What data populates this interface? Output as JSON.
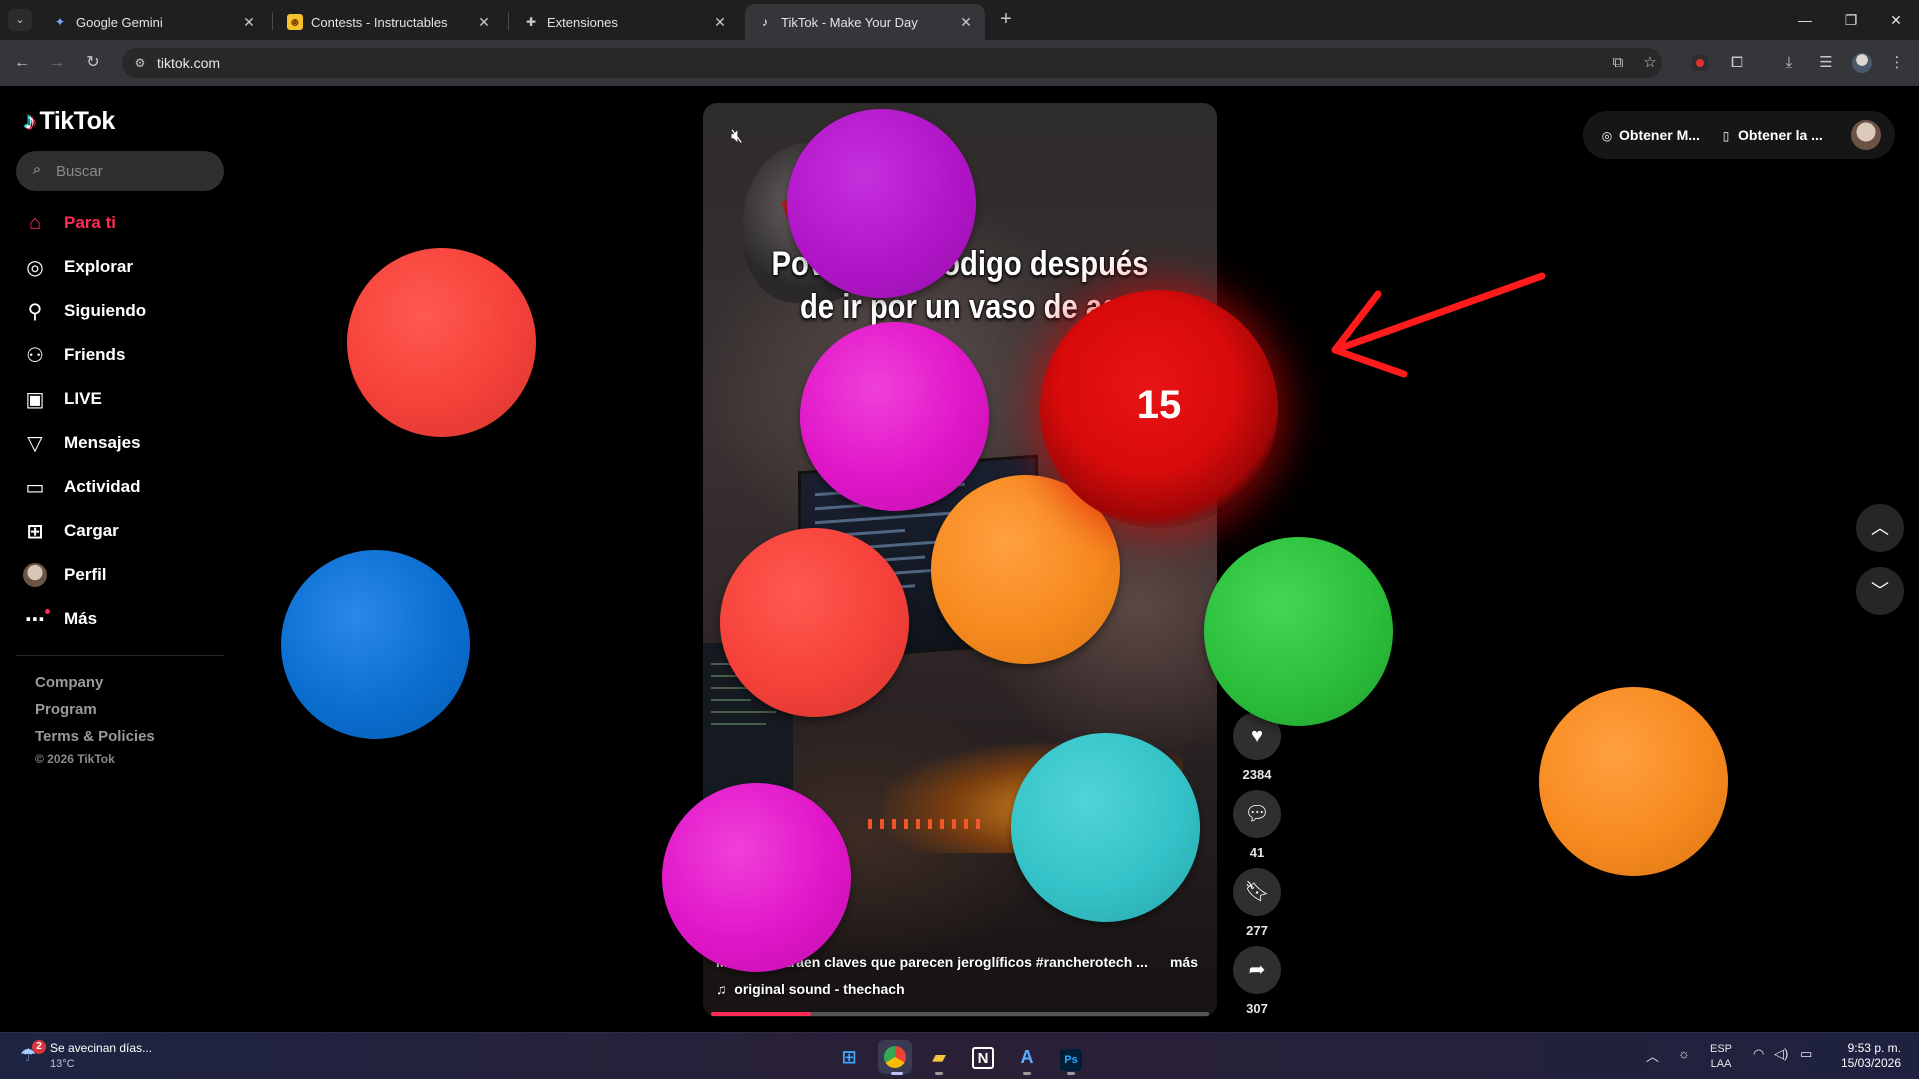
{
  "browser": {
    "tabs": [
      {
        "title": "Google Gemini",
        "icon": "gemini-icon"
      },
      {
        "title": "Contests - Instructables",
        "icon": "instructables-icon"
      },
      {
        "title": "Extensiones",
        "icon": "puzzle-icon"
      },
      {
        "title": "TikTok - Make Your Day",
        "icon": "tiktok-icon",
        "active": true
      }
    ],
    "url": "tiktok.com"
  },
  "tiktok": {
    "brand": "TikTok",
    "search_placeholder": "Buscar",
    "nav": [
      {
        "label": "Para ti",
        "icon": "home-icon",
        "active": true
      },
      {
        "label": "Explorar",
        "icon": "compass-icon"
      },
      {
        "label": "Siguiendo",
        "icon": "following-icon"
      },
      {
        "label": "Friends",
        "icon": "friends-icon"
      },
      {
        "label": "LIVE",
        "icon": "live-icon"
      },
      {
        "label": "Mensajes",
        "icon": "messages-icon"
      },
      {
        "label": "Actividad",
        "icon": "activity-icon"
      },
      {
        "label": "Cargar",
        "icon": "upload-icon"
      },
      {
        "label": "Perfil",
        "icon": "avatar"
      },
      {
        "label": "Más",
        "icon": "more-icon"
      }
    ],
    "footer": [
      "Company",
      "Program",
      "Terms & Policies"
    ],
    "copyright": "© 2026 TikTok",
    "top_actions": [
      "Obtener M...",
      "Obtener la ..."
    ],
    "video": {
      "caption_line1": "Pov: n        código después",
      "caption_line2": "de ir por un vaso de ag",
      "description": "M          se traen claves que parecen jeroglíficos #rancherotech ...",
      "more": "más",
      "sound": "original sound - thechach",
      "progress": 0.2
    },
    "actions": {
      "likes": "2384",
      "comments": "41",
      "saves": "277",
      "shares": "307"
    }
  },
  "overlay": {
    "highlight_number": "15",
    "colors": {
      "red": "#f5413a",
      "purple": "#b215c9",
      "magenta": "#e016c9",
      "orange": "#f78a1f",
      "green": "#2bbf3b",
      "blue": "#0a6fd1",
      "teal": "#34c3c8",
      "dark_red": "#d90b0b"
    }
  },
  "taskbar": {
    "weather_title": "Se avecinan días...",
    "weather_temp": "13°C",
    "weather_badge": "2",
    "lang_top": "ESP",
    "lang_bottom": "LAA",
    "time": "9:53 p. m.",
    "date": "15/03/2026"
  }
}
